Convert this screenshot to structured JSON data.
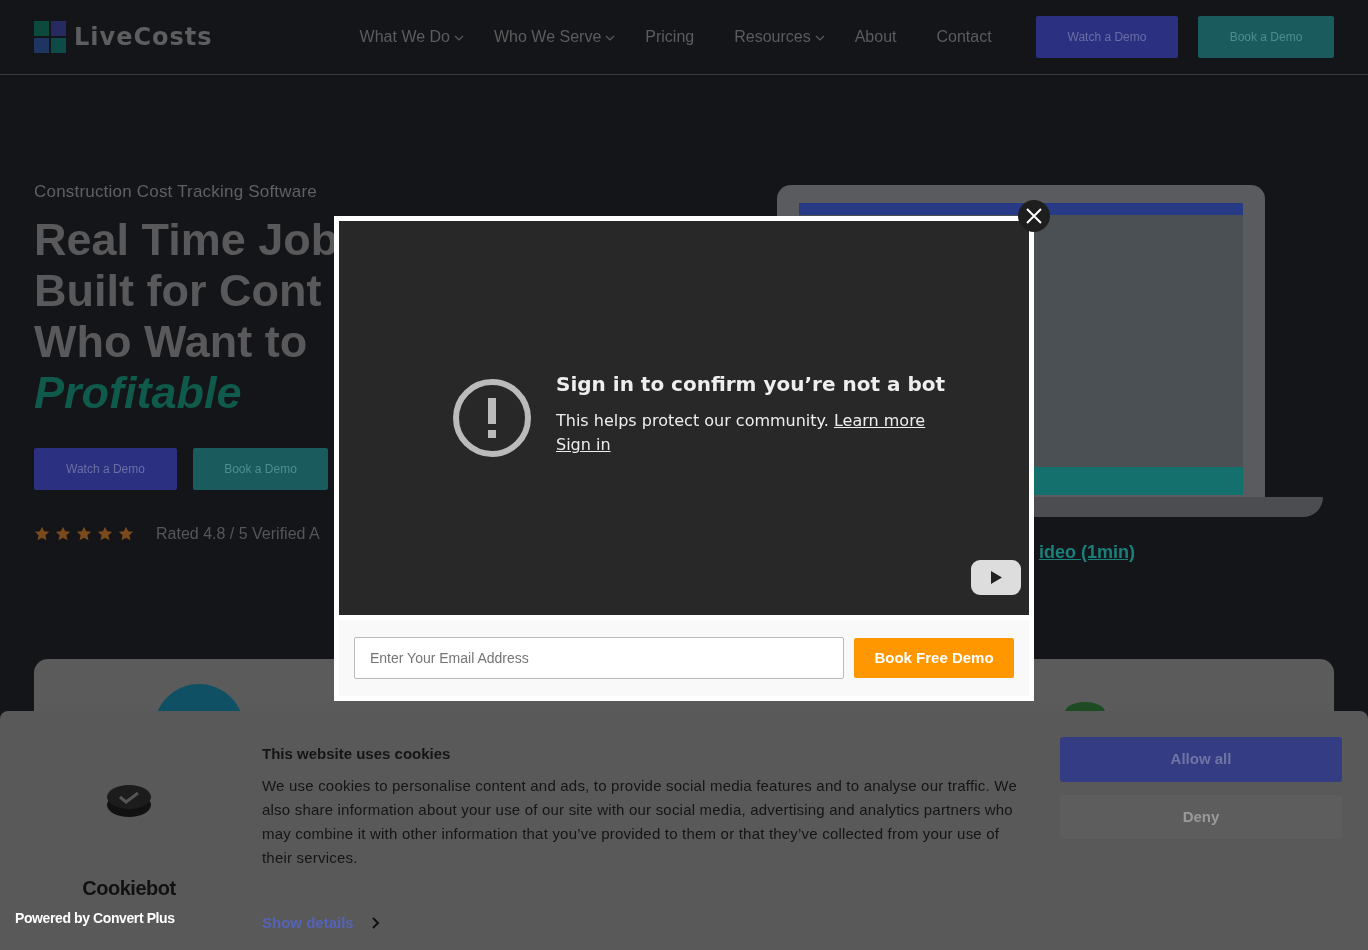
{
  "nav": {
    "logo": "LiveCosts",
    "items": [
      {
        "label": "What We Do",
        "dropdown": true
      },
      {
        "label": "Who We Serve",
        "dropdown": true
      },
      {
        "label": "Pricing",
        "dropdown": false
      },
      {
        "label": "Resources",
        "dropdown": true
      },
      {
        "label": "About",
        "dropdown": false
      },
      {
        "label": "Contact",
        "dropdown": false
      }
    ],
    "buttons": [
      {
        "label": "Watch a Demo",
        "kind": "primary"
      },
      {
        "label": "Book a Demo",
        "kind": "secondary"
      }
    ]
  },
  "hero": {
    "eyebrow": "Construction Cost Tracking Software",
    "headline_lines": [
      "Real Time Job",
      "Built for Cont",
      "Who Want to"
    ],
    "highlight": "Profitable",
    "buttons": [
      {
        "label": "Watch a Demo",
        "kind": "primary"
      },
      {
        "label": "Book a Demo",
        "kind": "secondary"
      }
    ],
    "stars": 5,
    "rating": "Rated 4.8 / 5 Verified A",
    "video_link": "ideo (1min)"
  },
  "video_popup": {
    "title": "Sign in to confirm you’re not a bot",
    "message": "This helps protect our community.",
    "learn_more": "Learn more",
    "sign_in": "Sign in",
    "email": {
      "placeholder": "Enter Your Email Address"
    },
    "submit": "Book Free Demo"
  },
  "cookie_banner": {
    "brand": "Cookiebot",
    "title": "This website uses cookies",
    "text": "We use cookies to personalise content and ads, to provide social media features and to analyse our traffic. We also share information about your use of our site with our social media, advertising and analytics partners who may combine it with other information that you’ve provided to them or that they’ve collected from your use of their services.",
    "show_details": "Show details",
    "buttons": [
      {
        "label": "Allow all",
        "kind": "primary"
      },
      {
        "label": "Deny",
        "kind": "secondary"
      }
    ]
  },
  "badge": "Powered by Convert Plus"
}
